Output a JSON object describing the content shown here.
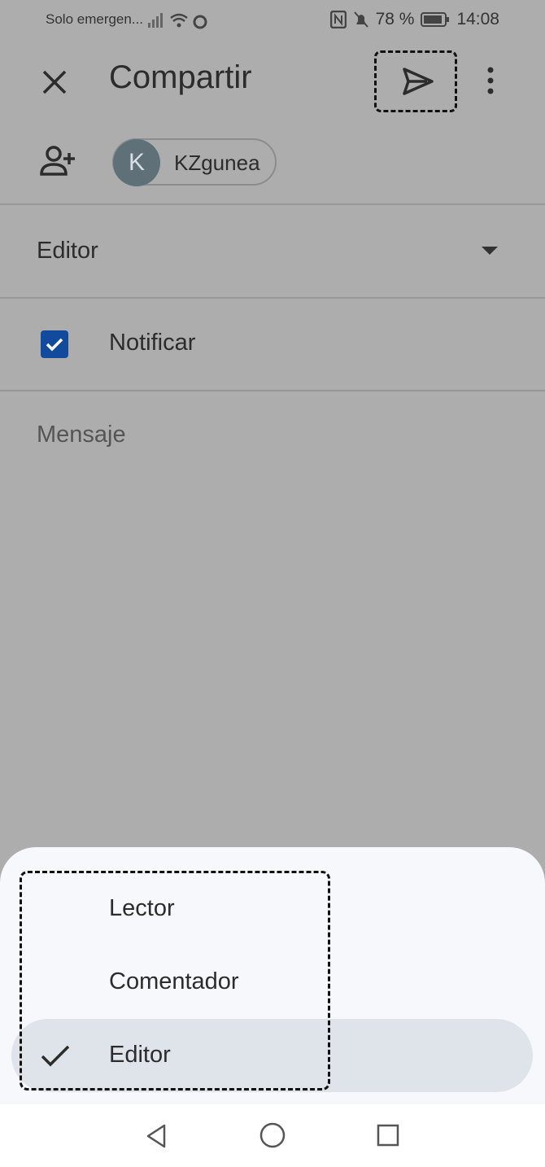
{
  "status_bar": {
    "carrier": "Solo emergen...",
    "battery": "78 %",
    "time": "14:08"
  },
  "header": {
    "title": "Compartir"
  },
  "recipient": {
    "initial": "K",
    "name": "KZgunea"
  },
  "role_selector": {
    "value": "Editor"
  },
  "notify": {
    "label": "Notificar",
    "checked": true
  },
  "message": {
    "placeholder": "Mensaje"
  },
  "role_menu": {
    "items": [
      "Lector",
      "Comentador",
      "Editor"
    ],
    "selected": "Editor"
  },
  "colors": {
    "checkbox": "#124a9e",
    "avatar": "#5f7079",
    "sheet": "#f6f8fc",
    "selected_pill": "#dfe4ea"
  }
}
